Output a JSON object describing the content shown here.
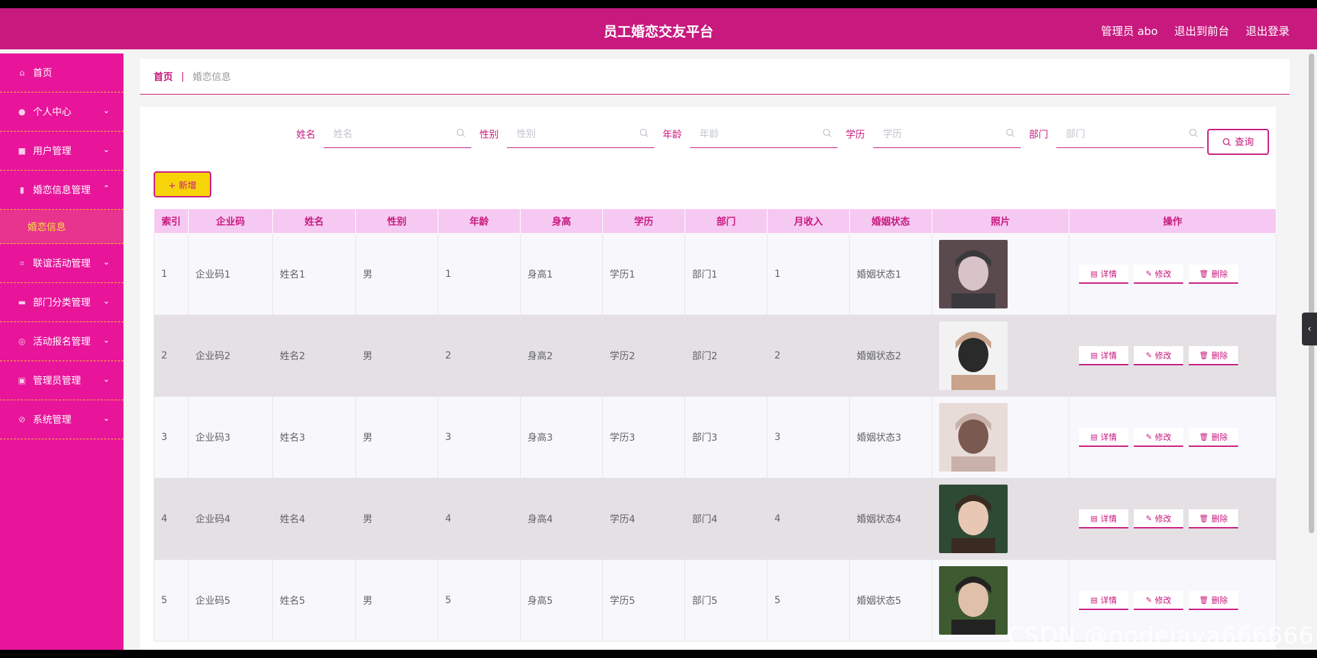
{
  "header": {
    "title": "员工婚恋交友平台",
    "admin_label": "管理员 abo",
    "to_front": "退出到前台",
    "logout": "退出登录"
  },
  "sidebar": {
    "items": [
      {
        "label": "首页",
        "icon": "home-icon",
        "chevron": ""
      },
      {
        "label": "个人中心",
        "icon": "user-icon",
        "chevron": "⌄"
      },
      {
        "label": "用户管理",
        "icon": "users-icon",
        "chevron": "⌄"
      },
      {
        "label": "婚恋信息管理",
        "icon": "chart-icon",
        "chevron": "⌃"
      },
      {
        "label": "联谊活动管理",
        "icon": "crop-icon",
        "chevron": "⌄"
      },
      {
        "label": "部门分类管理",
        "icon": "briefcase-icon",
        "chevron": "⌄"
      },
      {
        "label": "活动报名管理",
        "icon": "compass-icon",
        "chevron": "⌄"
      },
      {
        "label": "管理员管理",
        "icon": "clipboard-icon",
        "chevron": "⌄"
      },
      {
        "label": "系统管理",
        "icon": "settings-icon",
        "chevron": "⌄"
      }
    ],
    "submenu_active": "婚恋信息"
  },
  "breadcrumb": {
    "home": "首页",
    "separator": "|",
    "current": "婚恋信息"
  },
  "search": {
    "fields": [
      {
        "label": "姓名",
        "placeholder": "姓名"
      },
      {
        "label": "性别",
        "placeholder": "性别"
      },
      {
        "label": "年龄",
        "placeholder": "年龄"
      },
      {
        "label": "学历",
        "placeholder": "学历"
      },
      {
        "label": "部门",
        "placeholder": "部门"
      }
    ],
    "query_label": "查询",
    "add_label": "+ 新增"
  },
  "table": {
    "columns": [
      "索引",
      "企业码",
      "姓名",
      "性别",
      "年龄",
      "身高",
      "学历",
      "部门",
      "月收入",
      "婚姻状态",
      "照片",
      "操作"
    ],
    "rows": [
      {
        "idx": "1",
        "code": "企业码1",
        "name": "姓名1",
        "gender": "男",
        "age": "1",
        "height": "身高1",
        "edu": "学历1",
        "dept": "部门1",
        "income": "1",
        "status": "婚姻状态1"
      },
      {
        "idx": "2",
        "code": "企业码2",
        "name": "姓名2",
        "gender": "男",
        "age": "2",
        "height": "身高2",
        "edu": "学历2",
        "dept": "部门2",
        "income": "2",
        "status": "婚姻状态2"
      },
      {
        "idx": "3",
        "code": "企业码3",
        "name": "姓名3",
        "gender": "男",
        "age": "3",
        "height": "身高3",
        "edu": "学历3",
        "dept": "部门3",
        "income": "3",
        "status": "婚姻状态3"
      },
      {
        "idx": "4",
        "code": "企业码4",
        "name": "姓名4",
        "gender": "男",
        "age": "4",
        "height": "身高4",
        "edu": "学历4",
        "dept": "部门4",
        "income": "4",
        "status": "婚姻状态4"
      },
      {
        "idx": "5",
        "code": "企业码5",
        "name": "姓名5",
        "gender": "男",
        "age": "5",
        "height": "身高5",
        "edu": "学历5",
        "dept": "部门5",
        "income": "5",
        "status": "婚姻状态5"
      }
    ],
    "actions": {
      "detail": "详情",
      "edit": "修改",
      "delete": "删除"
    }
  },
  "watermark": "CSDN @nodejava666666",
  "colors": {
    "brand": "#c8197f",
    "sidebar": "#e8159b",
    "accent_yellow": "#f7d40a",
    "header_row": "#f6c9f2"
  }
}
